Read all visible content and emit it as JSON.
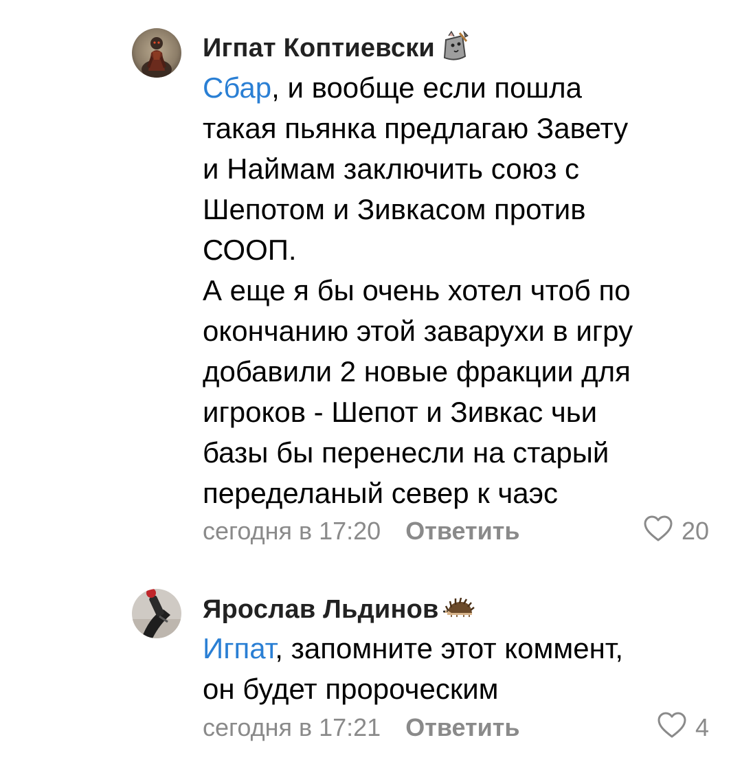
{
  "comments": [
    {
      "author": "Игпат Коптиевски",
      "author_badge_icon": "rat-miner-sticker-icon",
      "mention": "Сбар",
      "text_first_line_rest": ", и вообще если пошла",
      "text_lines": [
        "такая пьянка предлагаю Завету",
        "и Наймам заключить союз с",
        "Шепотом и Зивкасом против",
        "СООП.",
        "А еще я бы очень хотел чтоб по",
        "окончанию этой заварухи в игру",
        "добавили 2 новые фракции для",
        "игроков - Шепот и Зивкас чьи",
        "базы бы перенесли на старый",
        "переделаный север к чаэс"
      ],
      "date": "сегодня в 17:20",
      "reply_label": "Ответить",
      "like_icon": "heart-outline-icon",
      "likes": "20"
    },
    {
      "author": "Ярослав Льдинов",
      "author_badge_icon": "hedgehog-icon",
      "mention": "Игпат",
      "text_first_line_rest": ", запомните этот коммент,",
      "text_lines": [
        "он будет пророческим"
      ],
      "date": "сегодня в 17:21",
      "reply_label": "Ответить",
      "like_icon": "heart-outline-icon",
      "likes": "4"
    }
  ],
  "colors": {
    "mention": "#2a7fd4",
    "meta_text": "#8a8a8a",
    "author": "#222222"
  }
}
